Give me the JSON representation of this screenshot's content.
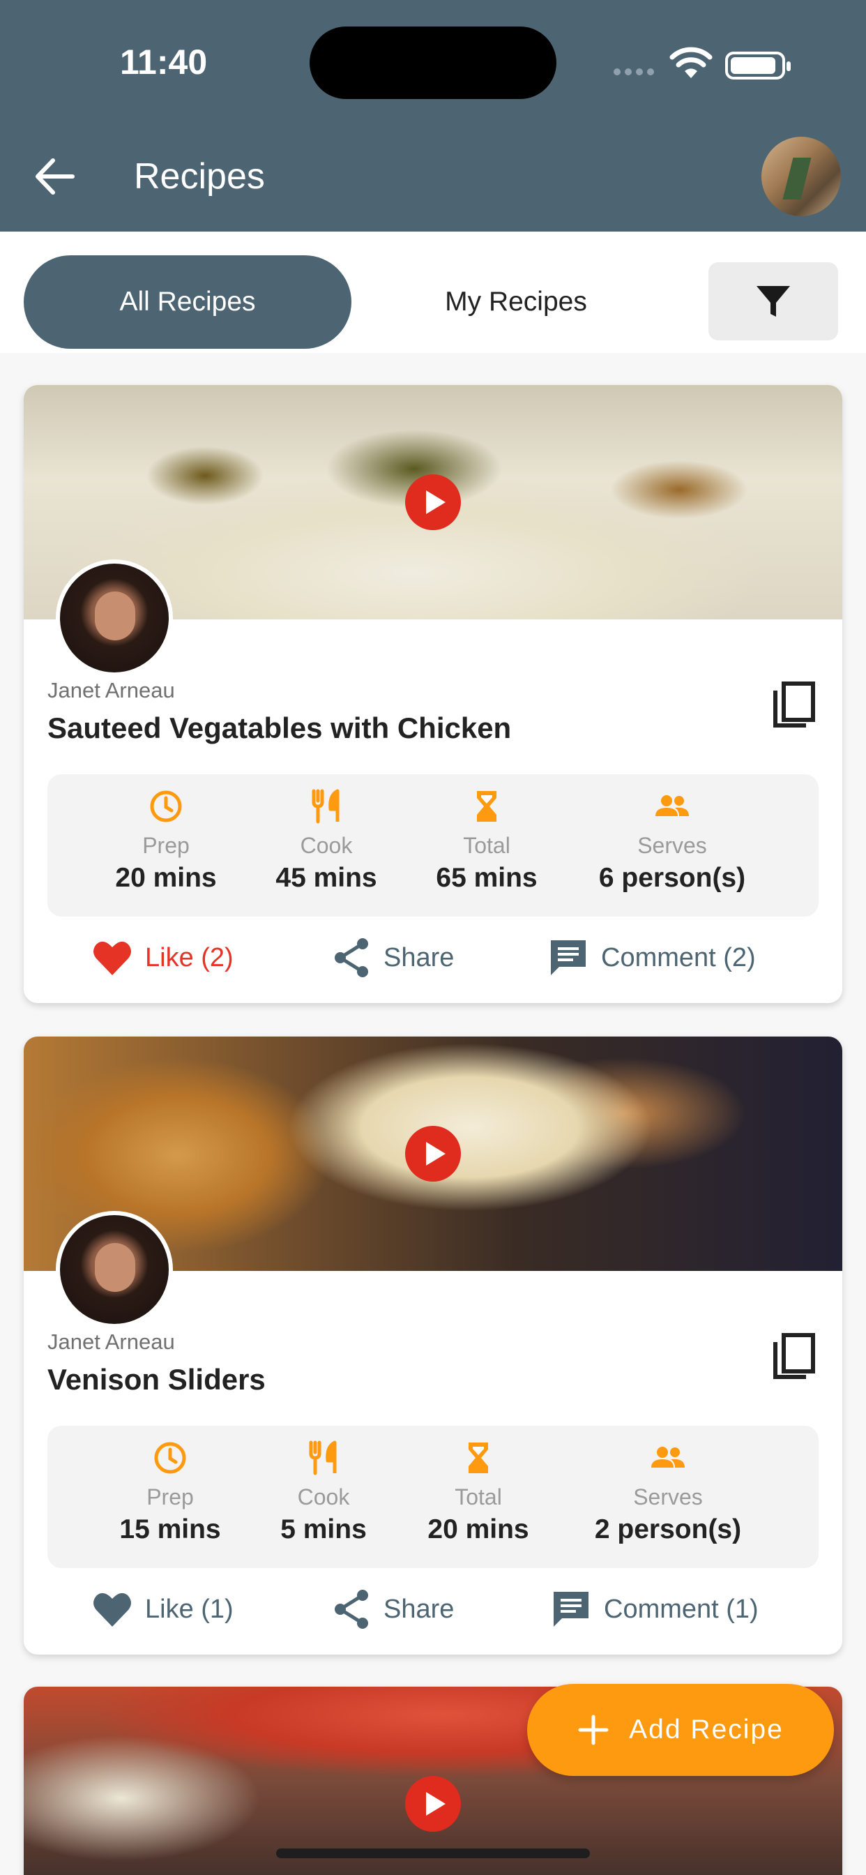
{
  "status_bar": {
    "time": "11:40"
  },
  "app_bar": {
    "title": "Recipes"
  },
  "tabs": {
    "all": "All Recipes",
    "mine": "My Recipes"
  },
  "recipes": [
    {
      "author": "Janet Arneau",
      "title": "Sauteed Vegatables with Chicken",
      "stats": [
        {
          "label": "Prep",
          "value": "20 mins",
          "icon": "clock-icon"
        },
        {
          "label": "Cook",
          "value": "45 mins",
          "icon": "fork-knife-icon"
        },
        {
          "label": "Total",
          "value": "65 mins",
          "icon": "hourglass-icon"
        },
        {
          "label": "Serves",
          "value": "6 person(s)",
          "icon": "people-icon"
        }
      ],
      "like_label": "Like (2)",
      "liked": true,
      "share_label": "Share",
      "comment_label": "Comment (2)"
    },
    {
      "author": "Janet Arneau",
      "title": "Venison Sliders",
      "stats": [
        {
          "label": "Prep",
          "value": "15 mins",
          "icon": "clock-icon"
        },
        {
          "label": "Cook",
          "value": "5 mins",
          "icon": "fork-knife-icon"
        },
        {
          "label": "Total",
          "value": "20 mins",
          "icon": "hourglass-icon"
        },
        {
          "label": "Serves",
          "value": "2 person(s)",
          "icon": "people-icon"
        }
      ],
      "like_label": "Like (1)",
      "liked": false,
      "share_label": "Share",
      "comment_label": "Comment (1)"
    }
  ],
  "fab": {
    "label": "Add Recipe"
  },
  "colors": {
    "header": "#4d6573",
    "accent": "#fd9a10",
    "like": "#e53425",
    "play": "#e02b1f"
  }
}
